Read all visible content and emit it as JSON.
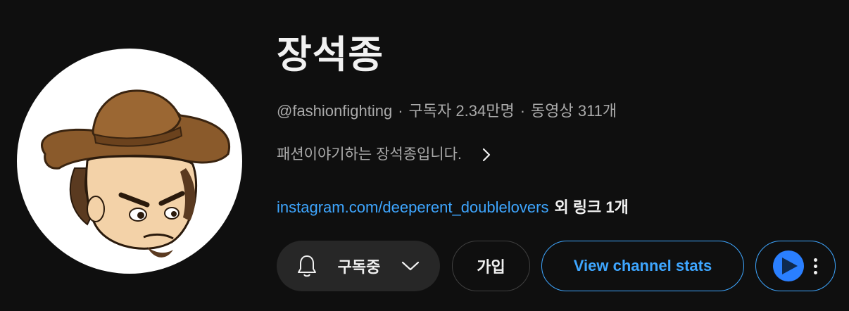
{
  "channel": {
    "name": "장석종",
    "handle": "@fashionfighting",
    "subscribers": "구독자 2.34만명",
    "videos": "동영상 311개",
    "meta_separator": "·",
    "description": "패션이야기하는 장석종입니다.",
    "link_text": "instagram.com/deeperent_doublelovers",
    "more_links": "외 링크 1개"
  },
  "actions": {
    "subscribe_label": "구독중",
    "join_label": "가입",
    "stats_label": "View channel stats"
  },
  "icons": {
    "bell": "bell-icon",
    "chevron_down": "chevron-down-icon",
    "chevron_right": "chevron-right-icon",
    "extension": "iq-extension-icon",
    "more": "more-vert-icon",
    "avatar": "cowboy-cartoon-avatar"
  },
  "colors": {
    "background": "#0f0f0f",
    "link": "#3ea6ff",
    "secondary_text": "#aaaaaa",
    "button_bg": "#272727"
  }
}
